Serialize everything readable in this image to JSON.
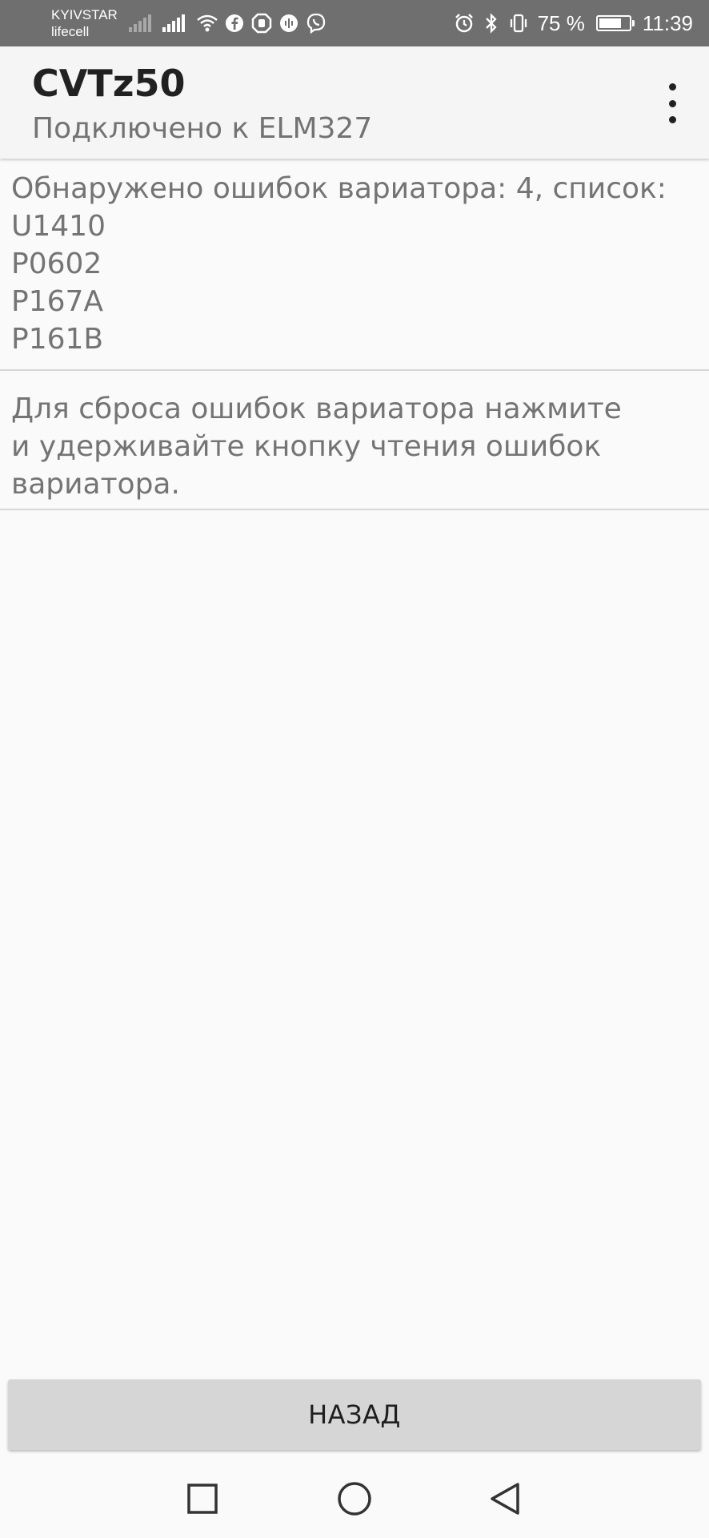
{
  "status_bar": {
    "carrier_1": "KYIVSTAR",
    "carrier_2": "lifecell",
    "battery_percent": "75 %",
    "battery_level": 75,
    "time": "11:39",
    "icons": [
      "signal-weak-icon",
      "signal-strong-icon",
      "wifi-icon",
      "facebook-icon",
      "hand-icon",
      "audio-icon",
      "viber-icon",
      "alarm-icon",
      "bluetooth-icon",
      "vibrate-icon",
      "battery-icon"
    ]
  },
  "app_bar": {
    "title": "CVTz50",
    "subtitle": "Подключено к ELM327",
    "menu_icon": "more-vert-icon"
  },
  "errors": {
    "heading": "Обнаружено ошибок вариатора: 4, список:",
    "codes": [
      "U1410",
      "P0602",
      "P167A",
      "P161B"
    ]
  },
  "hint": {
    "lines": [
      "Для сброса ошибок вариатора нажмите",
      "и удерживайте кнопку чтения ошибок",
      "вариатора."
    ]
  },
  "back_button": {
    "label": "НАЗАД"
  },
  "nav_bar": {
    "icons": [
      "recent-apps-icon",
      "home-icon",
      "back-icon"
    ]
  },
  "colors": {
    "status_bar_bg": "#6f6f6f",
    "app_bar_bg": "#f5f5f5",
    "page_bg": "#fafafa",
    "body_text": "#747474",
    "button_bg": "#d6d6d6"
  }
}
